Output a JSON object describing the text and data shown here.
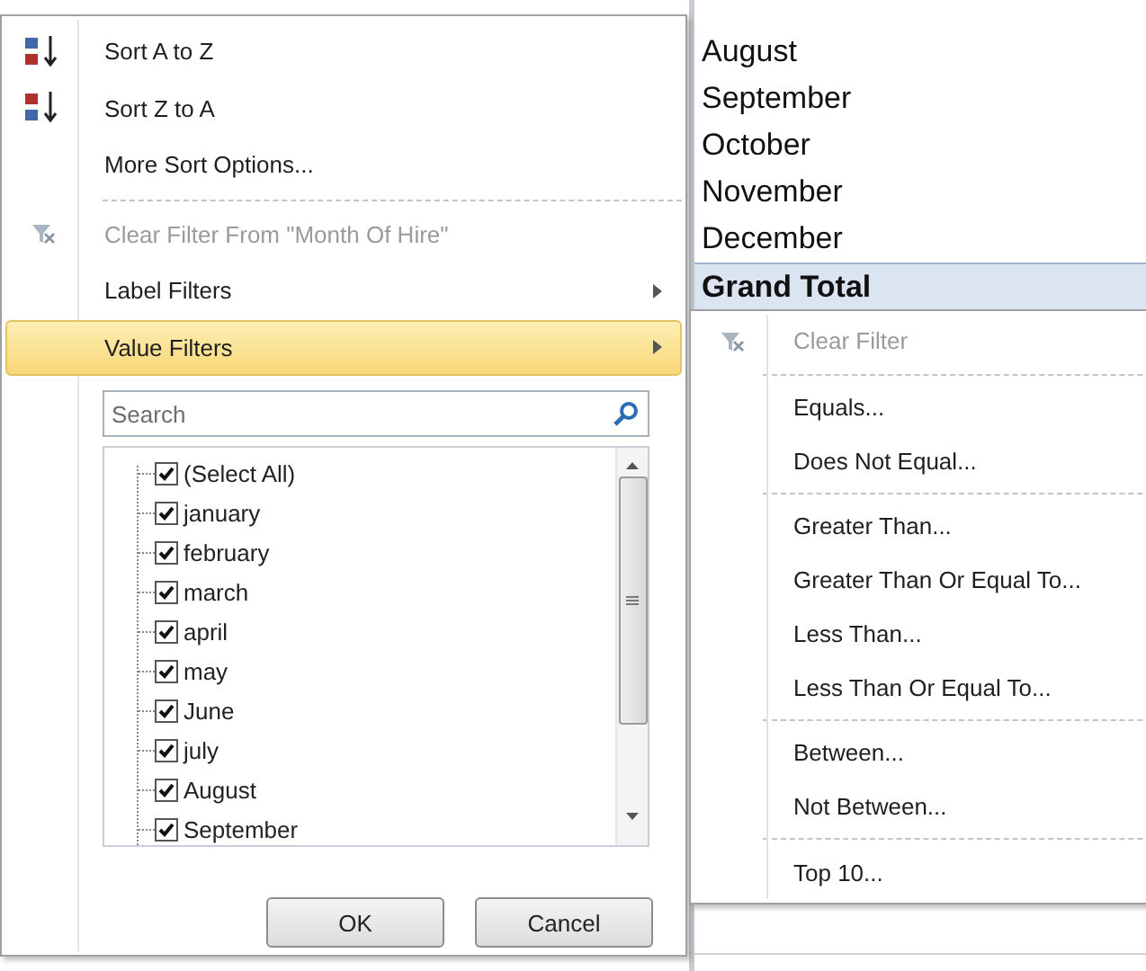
{
  "sheet_cells": [
    {
      "text": "August",
      "kind": "plain"
    },
    {
      "text": "September",
      "kind": "plain"
    },
    {
      "text": "October",
      "kind": "plain"
    },
    {
      "text": "November",
      "kind": "plain"
    },
    {
      "text": "December",
      "kind": "plain"
    },
    {
      "text": "Grand Total",
      "kind": "total"
    }
  ],
  "filter_menu": {
    "items": [
      {
        "kind": "sort_az",
        "label": "Sort A to Z",
        "disabled": false
      },
      {
        "kind": "sort_za",
        "label": "Sort Z to A",
        "disabled": false
      },
      {
        "kind": "plain",
        "label": "More Sort Options...",
        "disabled": false
      },
      {
        "kind": "separator"
      },
      {
        "kind": "clear",
        "label": "Clear Filter From \"Month Of Hire\"",
        "disabled": true
      },
      {
        "kind": "submenu",
        "label": "Label Filters",
        "disabled": false,
        "selected": false
      },
      {
        "kind": "submenu",
        "label": "Value Filters",
        "disabled": false,
        "selected": true
      }
    ],
    "search": {
      "placeholder": "Search"
    },
    "checklist": [
      {
        "label": "(Select All)",
        "checked": true
      },
      {
        "label": "january",
        "checked": true
      },
      {
        "label": "february",
        "checked": true
      },
      {
        "label": "march",
        "checked": true
      },
      {
        "label": "april",
        "checked": true
      },
      {
        "label": "may",
        "checked": true
      },
      {
        "label": "June",
        "checked": true
      },
      {
        "label": "july",
        "checked": true
      },
      {
        "label": "August",
        "checked": true
      },
      {
        "label": "September",
        "checked": true
      }
    ],
    "buttons": [
      "OK",
      "Cancel"
    ]
  },
  "value_filters_menu": [
    {
      "kind": "clear",
      "label": "Clear Filter",
      "disabled": true
    },
    {
      "kind": "separator"
    },
    {
      "kind": "plain",
      "label": "Equals...",
      "disabled": false
    },
    {
      "kind": "plain",
      "label": "Does Not Equal...",
      "disabled": false
    },
    {
      "kind": "separator"
    },
    {
      "kind": "plain",
      "label": "Greater Than...",
      "disabled": false
    },
    {
      "kind": "plain",
      "label": "Greater Than Or Equal To...",
      "disabled": false
    },
    {
      "kind": "plain",
      "label": "Less Than...",
      "disabled": false
    },
    {
      "kind": "plain",
      "label": "Less Than Or Equal To...",
      "disabled": false
    },
    {
      "kind": "separator"
    },
    {
      "kind": "plain",
      "label": "Between...",
      "disabled": false
    },
    {
      "kind": "plain",
      "label": "Not Between...",
      "disabled": false
    },
    {
      "kind": "separator"
    },
    {
      "kind": "plain",
      "label": "Top 10...",
      "disabled": false
    }
  ]
}
